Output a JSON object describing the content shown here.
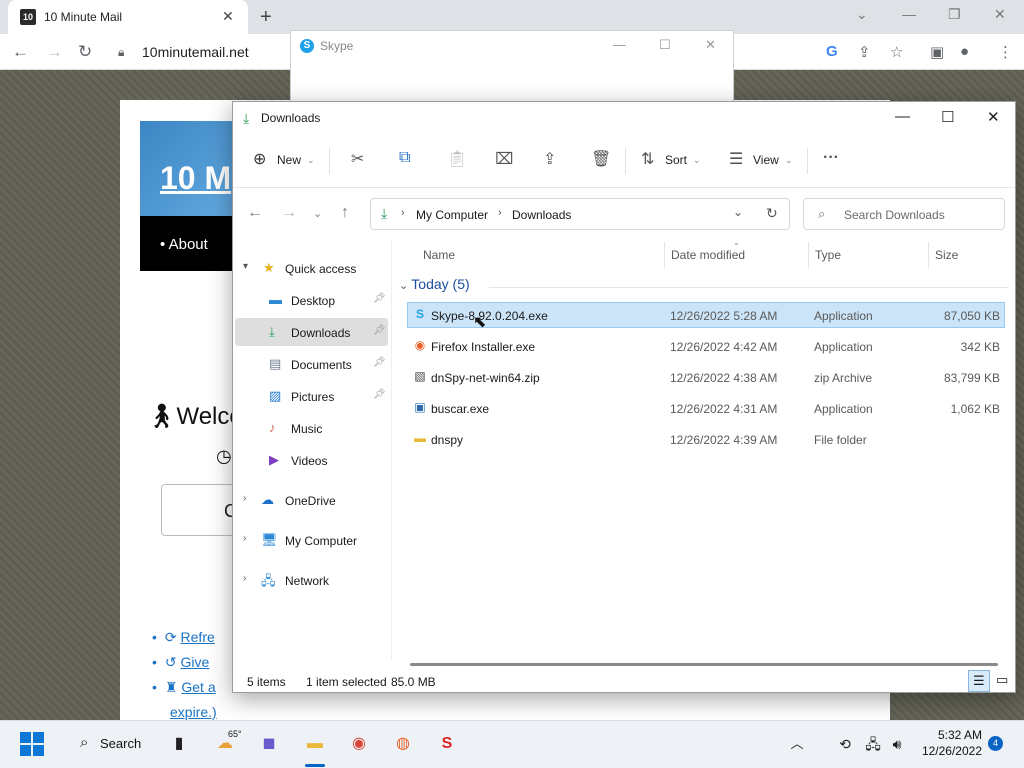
{
  "browser": {
    "tab_title": "10 Minute Mail",
    "tab_favicon": "10",
    "url": "10minutemail.net"
  },
  "site": {
    "logo": "10 M",
    "nav_about": "• About",
    "welcome": "Welco",
    "box_char": "C",
    "links": [
      {
        "icon": "refresh-icon",
        "text": "Refre"
      },
      {
        "icon": "history-icon",
        "text": "Give"
      },
      {
        "icon": "user-icon",
        "text": "Get a"
      }
    ],
    "expire": "expire.)"
  },
  "skype_window": {
    "title": "Skype",
    "icon_letter": "S"
  },
  "explorer": {
    "title": "Downloads",
    "toolbar": {
      "new_label": "New",
      "sort_label": "Sort",
      "view_label": "View"
    },
    "breadcrumb": [
      "My Computer",
      "Downloads"
    ],
    "search_placeholder": "Search Downloads",
    "nav": {
      "quick_access": "Quick access",
      "pinned": [
        {
          "label": "Desktop",
          "icon": "desktop-icon",
          "pinned": true
        },
        {
          "label": "Downloads",
          "icon": "downloads-icon",
          "pinned": true,
          "selected": true
        },
        {
          "label": "Documents",
          "icon": "documents-icon",
          "pinned": true
        },
        {
          "label": "Pictures",
          "icon": "pictures-icon",
          "pinned": true
        },
        {
          "label": "Music",
          "icon": "music-icon",
          "pinned": false
        },
        {
          "label": "Videos",
          "icon": "videos-icon",
          "pinned": false
        }
      ],
      "roots": [
        {
          "label": "OneDrive",
          "icon": "onedrive-icon"
        },
        {
          "label": "My Computer",
          "icon": "computer-icon"
        },
        {
          "label": "Network",
          "icon": "network-icon"
        }
      ]
    },
    "columns": {
      "name": "Name",
      "date": "Date modified",
      "type": "Type",
      "size": "Size"
    },
    "group_label": "Today (5)",
    "files": [
      {
        "name": "Skype-8.92.0.204.exe",
        "date": "12/26/2022 5:28 AM",
        "type": "Application",
        "size": "87,050 KB",
        "icon": "skype-installer-icon",
        "selected": true
      },
      {
        "name": "Firefox Installer.exe",
        "date": "12/26/2022 4:42 AM",
        "type": "Application",
        "size": "342 KB",
        "icon": "firefox-installer-icon"
      },
      {
        "name": "dnSpy-net-win64.zip",
        "date": "12/26/2022 4:38 AM",
        "type": "zip Archive",
        "size": "83,799 KB",
        "icon": "zip-icon"
      },
      {
        "name": "buscar.exe",
        "date": "12/26/2022 4:31 AM",
        "type": "Application",
        "size": "1,062 KB",
        "icon": "exe-icon"
      },
      {
        "name": "dnspy",
        "date": "12/26/2022 4:39 AM",
        "type": "File folder",
        "size": "",
        "icon": "folder-icon"
      }
    ],
    "status": {
      "items": "5 items",
      "selected": "1 item selected",
      "size": "85.0 MB"
    }
  },
  "taskbar": {
    "search": "Search",
    "weather": "65°",
    "time": "5:32 AM",
    "date": "12/26/2022",
    "notifications": "4"
  }
}
